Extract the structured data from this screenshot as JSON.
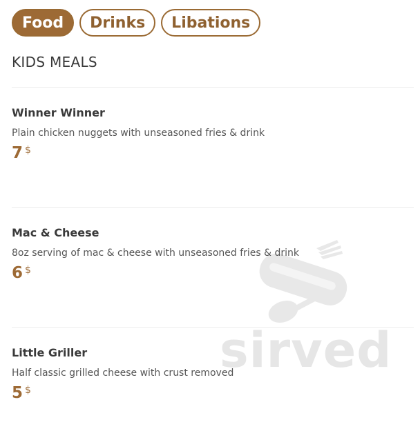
{
  "tabs": [
    {
      "label": "Food",
      "active": true
    },
    {
      "label": "Drinks",
      "active": false
    },
    {
      "label": "Libations",
      "active": false
    }
  ],
  "section": {
    "title": "KIDS MEALS"
  },
  "items": [
    {
      "name": "Winner Winner",
      "description": "Plain chicken nuggets with unseasoned fries & drink",
      "price": "7",
      "currency": "$"
    },
    {
      "name": "Mac & Cheese",
      "description": "8oz serving of mac & cheese with unseasoned fries & drink",
      "price": "6",
      "currency": "$"
    },
    {
      "name": "Little Griller",
      "description": "Half classic grilled cheese with crust removed",
      "price": "5",
      "currency": "$"
    }
  ],
  "watermark": {
    "text": "sirved",
    "icon": "knife-fork-spoon-icon"
  },
  "colors": {
    "accent": "#9d6a35",
    "divider": "#ececec",
    "watermark": "#e6e6e6"
  }
}
